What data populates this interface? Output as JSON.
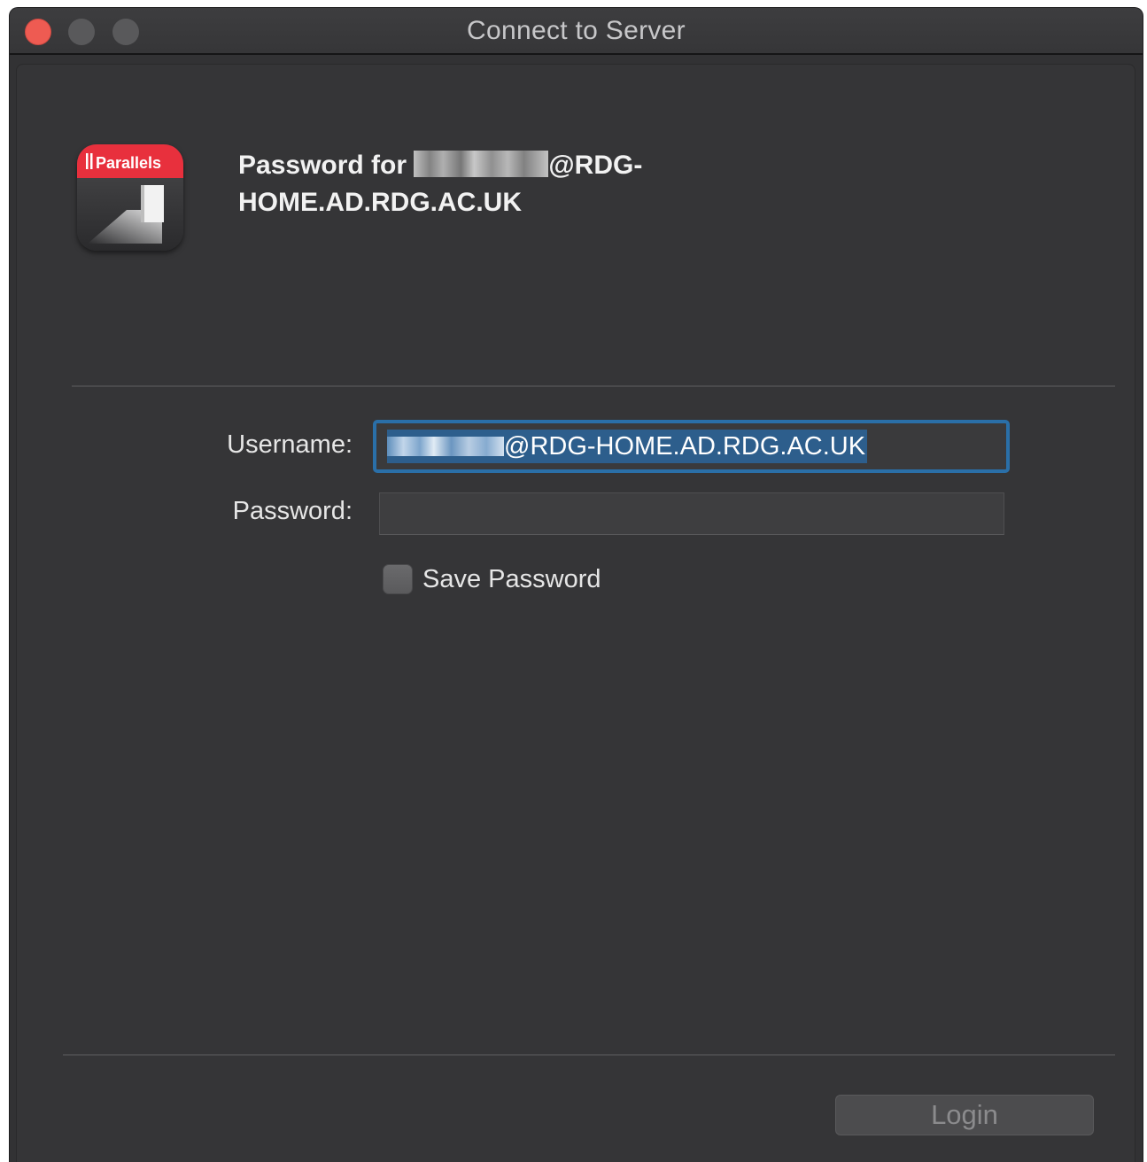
{
  "window": {
    "title": "Connect to Server"
  },
  "prompt": {
    "title_prefix": "Password for",
    "title_suffix": "@RDG-",
    "title_line2": "HOME.AD.RDG.AC.UK"
  },
  "app_icon": {
    "name": "parallels-icon",
    "brand_text": "Parallels",
    "brand_color": "#e8303d"
  },
  "form": {
    "username_label": "Username:",
    "username_value": "@RDG-HOME.AD.RDG.AC.UK",
    "password_label": "Password:",
    "password_value": "",
    "save_password_label": "Save Password",
    "save_password_checked": false
  },
  "buttons": {
    "login_label": "Login"
  },
  "colors": {
    "window_bg": "#323234",
    "focus_ring": "#2a6fa8",
    "selection": "#2d5e8c",
    "close_button": "#ee5b52"
  }
}
